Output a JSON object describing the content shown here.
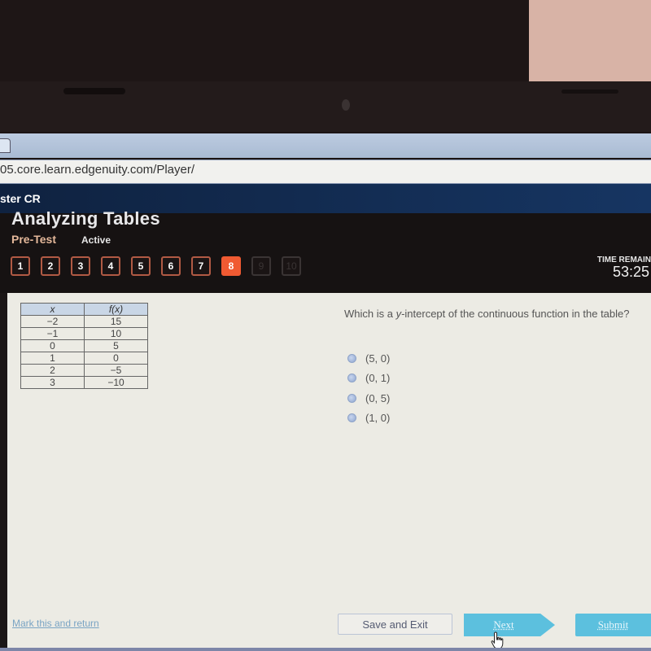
{
  "browser": {
    "url": "05.core.learn.edgenuity.com/Player/"
  },
  "app": {
    "course_title": "ster CR",
    "lesson_title": "Analyzing Tables",
    "activity_type": "Pre-Test",
    "status": "Active",
    "question_nav": [
      {
        "label": "1",
        "state": "answered"
      },
      {
        "label": "2",
        "state": "answered"
      },
      {
        "label": "3",
        "state": "answered"
      },
      {
        "label": "4",
        "state": "answered"
      },
      {
        "label": "5",
        "state": "answered"
      },
      {
        "label": "6",
        "state": "answered"
      },
      {
        "label": "7",
        "state": "answered"
      },
      {
        "label": "8",
        "state": "current"
      },
      {
        "label": "9",
        "state": "locked"
      },
      {
        "label": "10",
        "state": "locked"
      }
    ],
    "timer_label": "TIME REMAIN",
    "timer_value": "53:25",
    "accent_color": "#f05a32"
  },
  "table": {
    "headers": [
      "x",
      "f(x)"
    ],
    "rows": [
      [
        "−2",
        "15"
      ],
      [
        "−1",
        "10"
      ],
      [
        "0",
        "5"
      ],
      [
        "1",
        "0"
      ],
      [
        "2",
        "−5"
      ],
      [
        "3",
        "−10"
      ]
    ]
  },
  "question": {
    "prefix": "Which is a ",
    "emphasis": "y",
    "suffix": "-intercept of the continuous function in the table?",
    "choices": [
      "(5, 0)",
      "(0, 1)",
      "(0, 5)",
      "(1, 0)"
    ]
  },
  "footer": {
    "mark_label": "Mark this and return",
    "save_exit_label": "Save and Exit",
    "next_label": "Next",
    "submit_label": "Submit"
  }
}
